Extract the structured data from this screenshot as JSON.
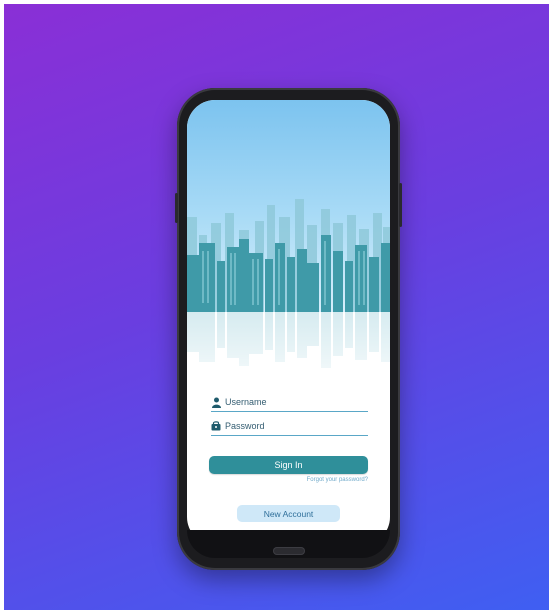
{
  "colors": {
    "background_start": "#8a2fd6",
    "background_end": "#3f5ff2",
    "phone_body": "#1c1c1f",
    "sky": "#7cc3ef",
    "skyline": "#3f9aa8",
    "accent": "#2f8f9a",
    "secondary_button": "#cfe8f8"
  },
  "login": {
    "username_placeholder": "Username",
    "password_placeholder": "Password",
    "username_icon": "user-icon",
    "password_icon": "lock-icon",
    "signin_label": "Sign In",
    "forgot_label": "Forgot your password?",
    "new_account_label": "New Account"
  }
}
